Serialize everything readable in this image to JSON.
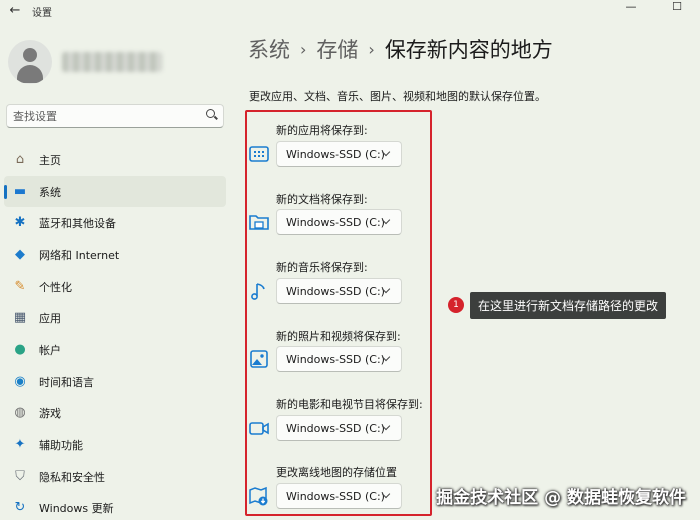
{
  "window": {
    "title": "设置",
    "back_glyph": "←",
    "minimize_glyph": "—",
    "maximize_glyph": "☐"
  },
  "search": {
    "placeholder": "查找设置"
  },
  "sidebar": {
    "items": [
      {
        "label": "主页",
        "icon": "home-icon",
        "glyph": "⌂",
        "color": "#7a6a58",
        "active": false
      },
      {
        "label": "系统",
        "icon": "monitor-icon",
        "glyph": "▬",
        "color": "#1c78d0",
        "active": true
      },
      {
        "label": "蓝牙和其他设备",
        "icon": "bluetooth-icon",
        "glyph": "✱",
        "color": "#1672c2",
        "active": false
      },
      {
        "label": "网络和 Internet",
        "icon": "wifi-icon",
        "glyph": "◆",
        "color": "#1d7ccc",
        "active": false
      },
      {
        "label": "个性化",
        "icon": "brush-icon",
        "glyph": "✎",
        "color": "#d58a2a",
        "active": false
      },
      {
        "label": "应用",
        "icon": "apps-icon",
        "glyph": "▦",
        "color": "#4a5a70",
        "active": false
      },
      {
        "label": "帐户",
        "icon": "account-icon",
        "glyph": "●",
        "color": "#2aa386",
        "active": false
      },
      {
        "label": "时间和语言",
        "icon": "globe-clock-icon",
        "glyph": "◉",
        "color": "#1a80c8",
        "active": false
      },
      {
        "label": "游戏",
        "icon": "gamepad-icon",
        "glyph": "◍",
        "color": "#6d6d6d",
        "active": false
      },
      {
        "label": "辅助功能",
        "icon": "accessibility-icon",
        "glyph": "✦",
        "color": "#1672c2",
        "active": false
      },
      {
        "label": "隐私和安全性",
        "icon": "shield-icon",
        "glyph": "⛉",
        "color": "#6a7078",
        "active": false
      },
      {
        "label": "Windows 更新",
        "icon": "update-icon",
        "glyph": "↻",
        "color": "#1672c2",
        "active": false
      }
    ]
  },
  "breadcrumb": {
    "part1": "系统",
    "part2": "存储",
    "current": "保存新内容的地方",
    "separator": "›"
  },
  "description": "更改应用、文档、音乐、图片、视频和地图的默认保存位置。",
  "save_locations": [
    {
      "label": "新的应用将保存到:",
      "icon": "app-window-icon",
      "value": "Windows-SSD (C:)"
    },
    {
      "label": "新的文档将保存到:",
      "icon": "document-folder-icon",
      "value": "Windows-SSD (C:)"
    },
    {
      "label": "新的音乐将保存到:",
      "icon": "music-note-icon",
      "value": "Windows-SSD (C:)"
    },
    {
      "label": "新的照片和视频将保存到:",
      "icon": "photo-icon",
      "value": "Windows-SSD (C:)"
    },
    {
      "label": "新的电影和电视节目将保存到:",
      "icon": "video-camera-icon",
      "value": "Windows-SSD (C:)"
    },
    {
      "label": "更改离线地图的存储位置",
      "icon": "map-download-icon",
      "value": "Windows-SSD (C:)"
    }
  ],
  "callout": {
    "number": "1",
    "text": "在这里进行新文档存储路径的更改"
  },
  "watermark": "掘金技术社区 @ 数据蛙恢复软件",
  "colors": {
    "accent": "#1672c2",
    "highlight": "#d5232c",
    "background": "#eef2e9"
  }
}
